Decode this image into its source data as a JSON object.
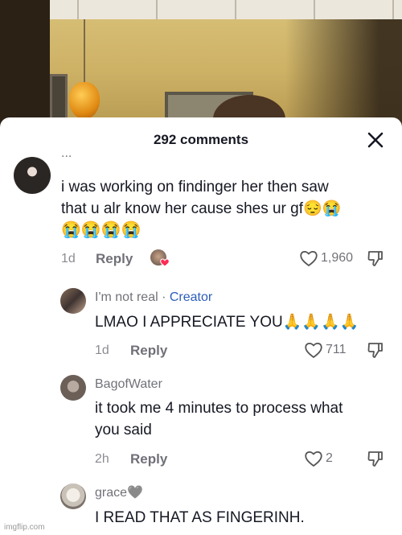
{
  "sheet": {
    "title": "292 comments"
  },
  "comments": [
    {
      "username": "...",
      "text_line1": "i was working on findinger her then saw",
      "text_line2": "that u alr know her cause shes ur gf",
      "text_emojis_inline": "😔😭",
      "text_emojis_line3": "😭😭😭😭",
      "time": "1d",
      "reply_label": "Reply",
      "likes": "1,960"
    },
    {
      "username": "I'm not real",
      "separator": "·",
      "badge": "Creator",
      "text": "LMAO I APPRECIATE YOU",
      "text_emojis": "🙏🙏🙏🙏",
      "time": "1d",
      "reply_label": "Reply",
      "likes": "711"
    },
    {
      "username": "BagofWater",
      "text_line1": "it took me 4 minutes to process what",
      "text_line2": "you said",
      "time": "2h",
      "reply_label": "Reply",
      "likes": "2"
    },
    {
      "username": "grace",
      "username_emoji": "🖤",
      "text": "I READ THAT AS FINGERINH."
    }
  ],
  "watermark": "imgflip.com"
}
